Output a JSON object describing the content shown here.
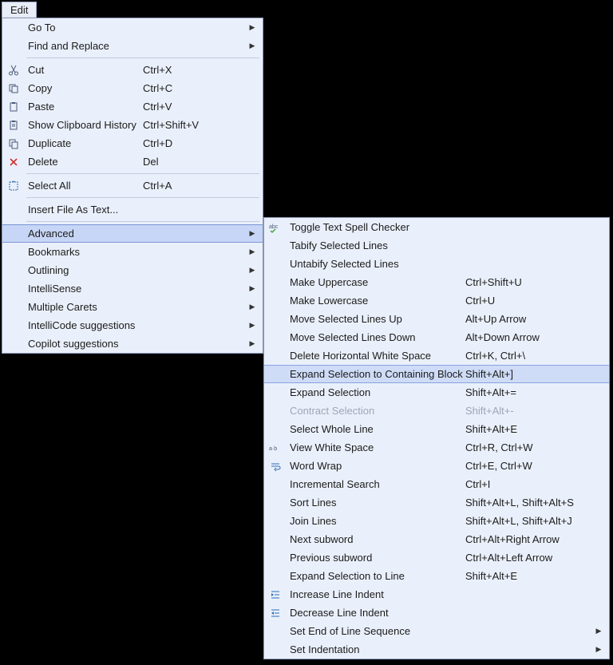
{
  "menu_title": "Edit",
  "main": {
    "goto": "Go To",
    "find": "Find and Replace",
    "cut": "Cut",
    "cut_k": "Ctrl+X",
    "copy": "Copy",
    "copy_k": "Ctrl+C",
    "paste": "Paste",
    "paste_k": "Ctrl+V",
    "cliphist": "Show Clipboard History",
    "cliphist_k": "Ctrl+Shift+V",
    "dup": "Duplicate",
    "dup_k": "Ctrl+D",
    "del": "Delete",
    "del_k": "Del",
    "selall": "Select All",
    "selall_k": "Ctrl+A",
    "insfile": "Insert File As Text...",
    "advanced": "Advanced",
    "bookmarks": "Bookmarks",
    "outlining": "Outlining",
    "intelli": "IntelliSense",
    "carets": "Multiple Carets",
    "intellicode": "IntelliCode suggestions",
    "copilot": "Copilot suggestions"
  },
  "adv": {
    "spell": "Toggle Text Spell Checker",
    "tabify": "Tabify Selected Lines",
    "untabify": "Untabify Selected Lines",
    "upper": "Make Uppercase",
    "upper_k": "Ctrl+Shift+U",
    "lower": "Make Lowercase",
    "lower_k": "Ctrl+U",
    "moveup": "Move Selected Lines Up",
    "moveup_k": "Alt+Up Arrow",
    "movedown": "Move Selected Lines Down",
    "movedown_k": "Alt+Down Arrow",
    "delhw": "Delete Horizontal White Space",
    "delhw_k": "Ctrl+K, Ctrl+\\",
    "expblock": "Expand Selection to Containing Block",
    "expblock_k": "Shift+Alt+]",
    "expsel": "Expand Selection",
    "expsel_k": "Shift+Alt+=",
    "contract": "Contract Selection",
    "contract_k": "Shift+Alt+-",
    "selline": "Select Whole Line",
    "selline_k": "Shift+Alt+E",
    "viewws": "View White Space",
    "viewws_k": "Ctrl+R, Ctrl+W",
    "wrap": "Word Wrap",
    "wrap_k": "Ctrl+E, Ctrl+W",
    "incsearch": "Incremental Search",
    "incsearch_k": "Ctrl+I",
    "sort": "Sort Lines",
    "sort_k": "Shift+Alt+L, Shift+Alt+S",
    "join": "Join Lines",
    "join_k": "Shift+Alt+L, Shift+Alt+J",
    "nextsub": "Next subword",
    "nextsub_k": "Ctrl+Alt+Right Arrow",
    "prevsub": "Previous subword",
    "prevsub_k": "Ctrl+Alt+Left Arrow",
    "expline": "Expand Selection to Line",
    "expline_k": "Shift+Alt+E",
    "incindent": "Increase Line Indent",
    "decindent": "Decrease Line Indent",
    "eol": "Set End of Line Sequence",
    "indent": "Set Indentation"
  }
}
